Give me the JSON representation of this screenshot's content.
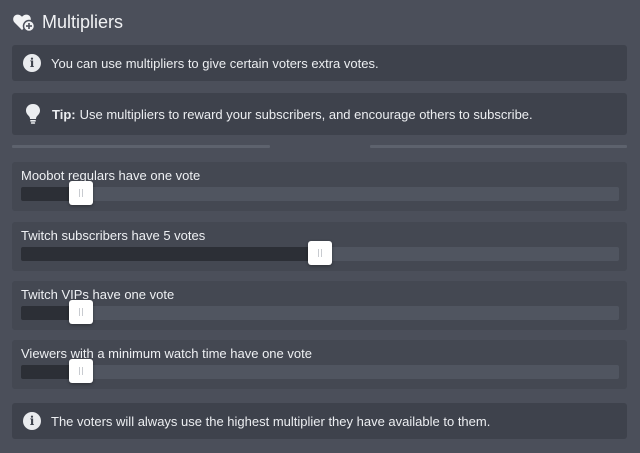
{
  "header": {
    "title": "Multipliers",
    "icon": "heart-plus-icon"
  },
  "notices": {
    "info_top": {
      "icon": "info-icon",
      "text": "You can use multipliers to give certain voters extra votes."
    },
    "tip": {
      "icon": "lightbulb-icon",
      "label": "Tip:",
      "text": "Use multipliers to reward your subscribers, and encourage others to subscribe."
    },
    "info_bottom": {
      "icon": "info-icon",
      "text": "The voters will always use the highest multiplier they have available to them."
    }
  },
  "sliders": [
    {
      "label": "Moobot regulars have one vote",
      "level": 0.1
    },
    {
      "label": "Twitch subscribers have 5 votes",
      "level": 0.5
    },
    {
      "label": "Twitch VIPs have one vote",
      "level": 0.1
    },
    {
      "label": "Viewers with a minimum watch time have one vote",
      "level": 0.1
    }
  ],
  "colors": {
    "background": "#4b4f5a",
    "panel": "#3e424c",
    "track": "#505560",
    "fill": "#2c2f36"
  }
}
